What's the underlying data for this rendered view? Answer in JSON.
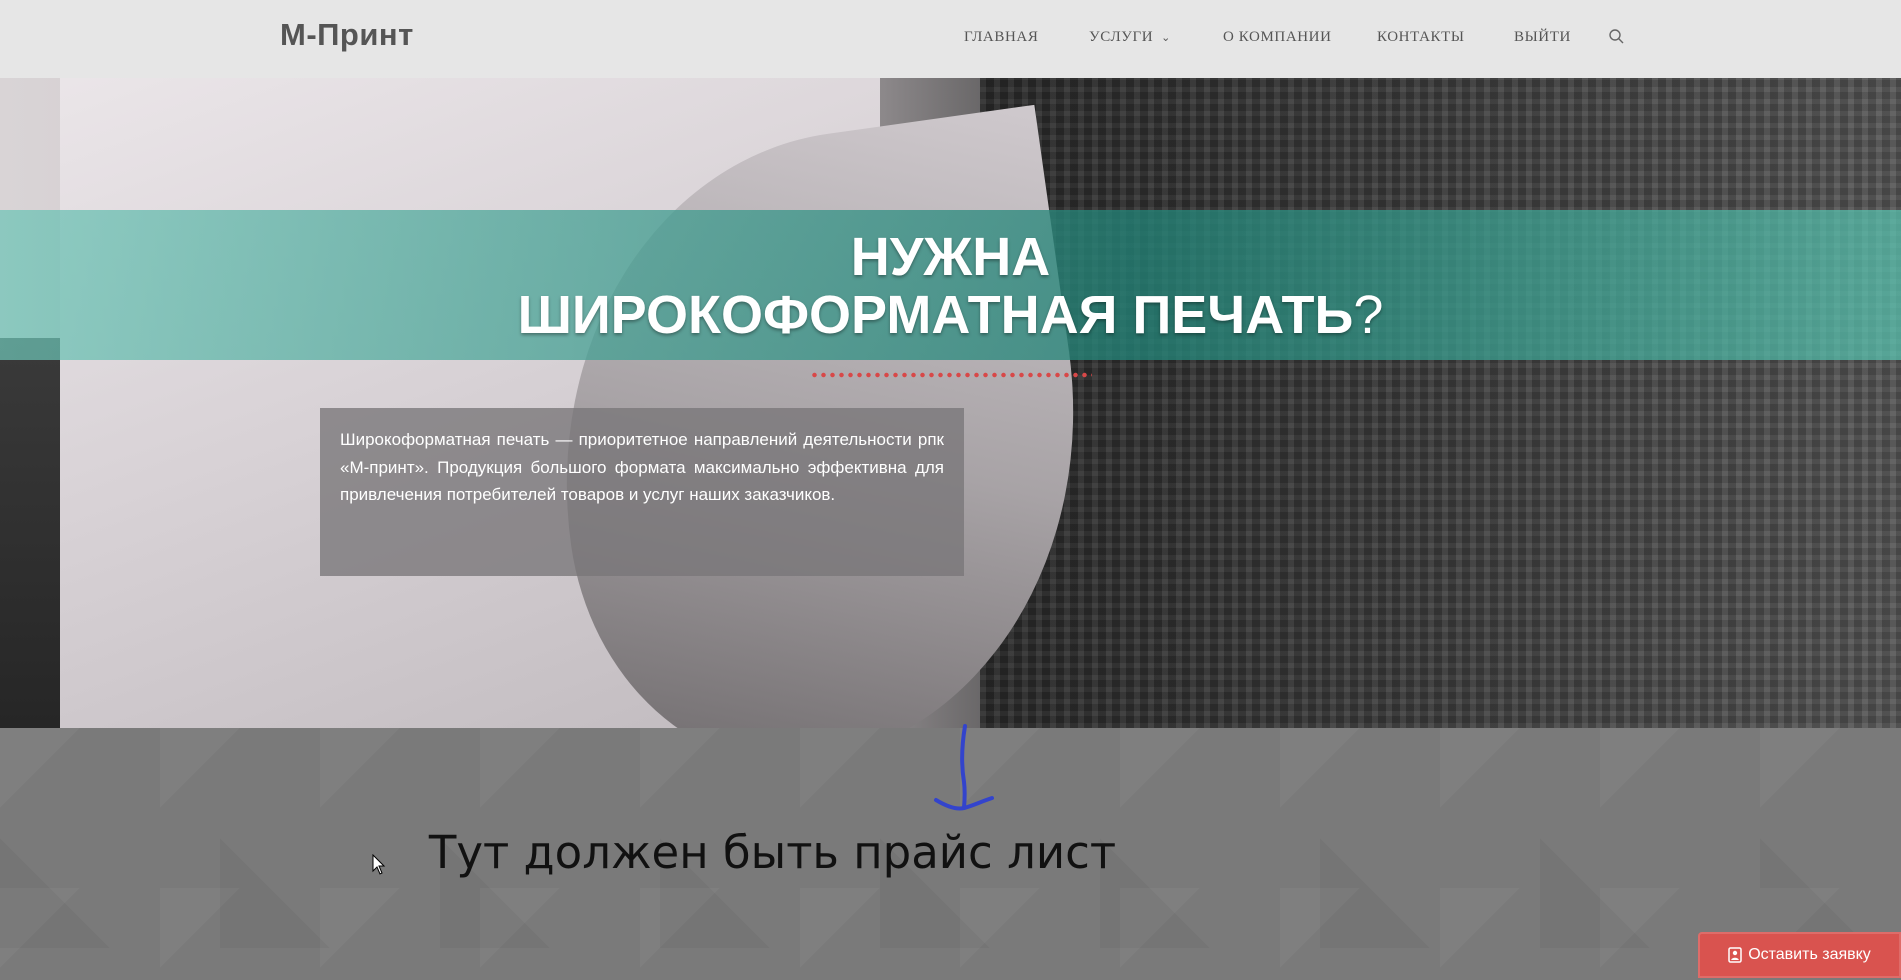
{
  "header": {
    "logo": "М-Принт",
    "nav": [
      {
        "label": "ГЛАВНАЯ"
      },
      {
        "label": "УСЛУГИ"
      },
      {
        "label": "О КОМПАНИИ"
      },
      {
        "label": "КОНТАКТЫ"
      },
      {
        "label": "ВЫЙТИ"
      }
    ],
    "search_icon": "search-icon",
    "dropdown_icon": "chevron-down-icon"
  },
  "hero": {
    "title_line1": "НУЖНА",
    "title_line2": "ШИРОКОФОРМАТНАЯ ПЕЧАТЬ",
    "title_mark": "?",
    "intro": "Широкоформатная печать — приоритетное направлений деятельности рпк «М-принт». Продукция большого формата максимально эффективна для привлечения потребителей товаров и услуг наших заказчиков."
  },
  "annotation": {
    "text": "Тут должен быть прайс лист",
    "arrow_color": "#3344cc"
  },
  "cta": {
    "label": "Оставить заявку",
    "icon": "person-badge-icon"
  },
  "colors": {
    "header_bg": "#e6e6e6",
    "band": "#2a8a7e",
    "accent_dots": "#d84848",
    "cta_bg": "#d9534f"
  }
}
